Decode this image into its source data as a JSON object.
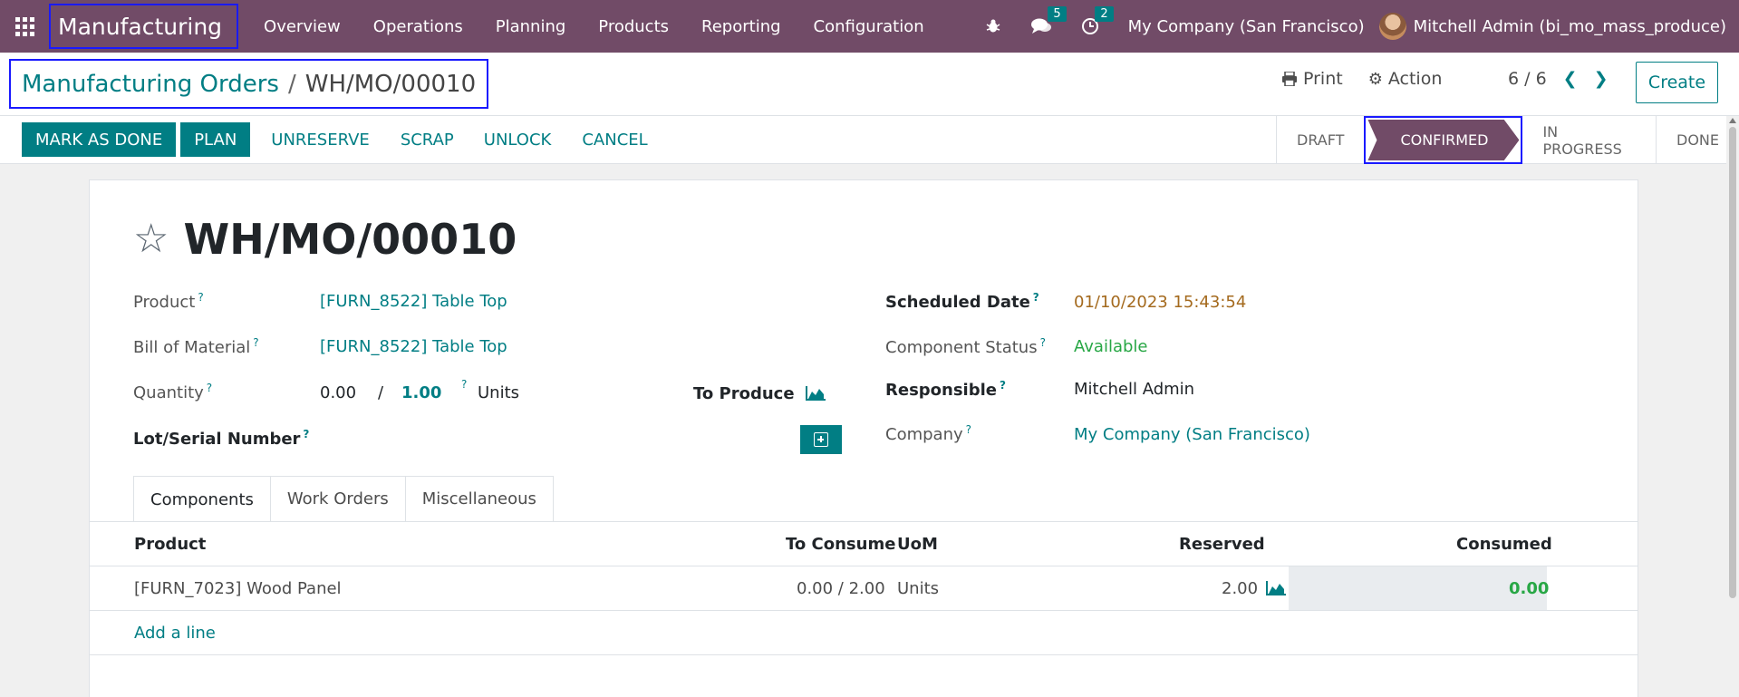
{
  "navbar": {
    "app_name": "Manufacturing",
    "menu": [
      "Overview",
      "Operations",
      "Planning",
      "Products",
      "Reporting",
      "Configuration"
    ],
    "messages_count": "5",
    "activities_count": "2",
    "company": "My Company (San Francisco)",
    "user": "Mitchell Admin (bi_mo_mass_produce)"
  },
  "breadcrumb": {
    "parent": "Manufacturing Orders",
    "separator": "/",
    "current": "WH/MO/00010"
  },
  "control": {
    "print": "Print",
    "action": "Action",
    "pager": "6 / 6",
    "create": "Create"
  },
  "statusbar": {
    "buttons": [
      "MARK AS DONE",
      "PLAN",
      "UNRESERVE",
      "SCRAP",
      "UNLOCK",
      "CANCEL"
    ],
    "stages": [
      "DRAFT",
      "CONFIRMED",
      "IN PROGRESS",
      "DONE"
    ],
    "active_stage": "CONFIRMED"
  },
  "record": {
    "title": "WH/MO/00010",
    "product_label": "Product",
    "product": "[FURN_8522] Table Top",
    "bom_label": "Bill of Material",
    "bom": "[FURN_8522] Table Top",
    "quantity_label": "Quantity",
    "qty_produced": "0.00",
    "qty_sep": "/",
    "qty_total": "1.00",
    "qty_uom": "Units",
    "to_produce_label": "To Produce",
    "lot_label": "Lot/Serial Number",
    "scheduled_label": "Scheduled Date",
    "scheduled": "01/10/2023 15:43:54",
    "component_status_label": "Component Status",
    "component_status": "Available",
    "responsible_label": "Responsible",
    "responsible": "Mitchell Admin",
    "company_label": "Company",
    "company": "My Company (San Francisco)",
    "help": "?"
  },
  "tabs": [
    "Components",
    "Work Orders",
    "Miscellaneous"
  ],
  "components": {
    "headers": [
      "Product",
      "To Consume",
      "UoM",
      "Reserved",
      "Consumed"
    ],
    "rows": [
      {
        "product": "[FURN_7023] Wood Panel",
        "to_consume": "0.00 /  2.00",
        "uom": "Units",
        "reserved": "2.00",
        "consumed": "0.00"
      }
    ],
    "add_line": "Add a line"
  },
  "colors": {
    "brand": "#714b67",
    "accent": "#017e84",
    "highlight_box": "#1a1aff"
  }
}
